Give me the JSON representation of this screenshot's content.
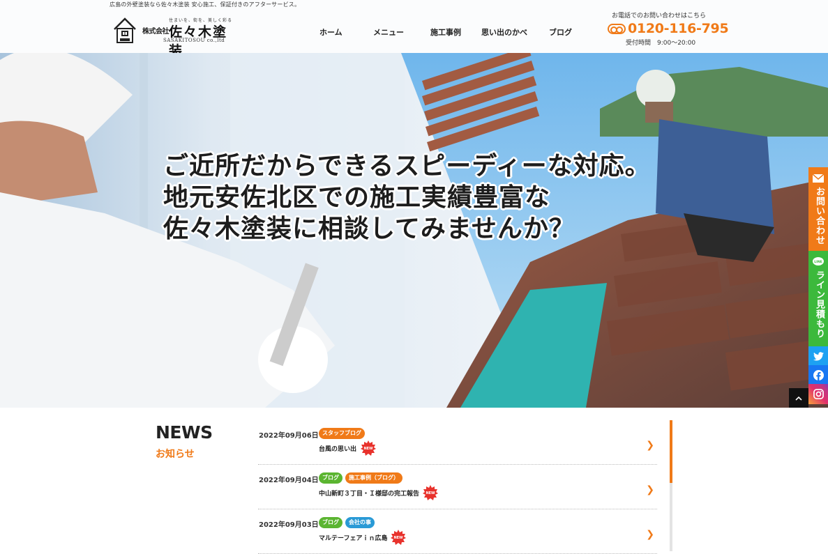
{
  "header": {
    "tagline": "広島の外壁塗装なら佐々木塗装 安心施工、保証付きのアフターサービス。",
    "logo": {
      "small_text": "住まいを、街を、美しく彩る",
      "kabushiki": "株式会社",
      "name": "佐々木塗装",
      "roman": "SASAKITOSOU co.,ltd"
    },
    "nav": [
      {
        "label": "ホーム"
      },
      {
        "label": "メニュー"
      },
      {
        "label": "施工事例"
      },
      {
        "label": "思い出のかべ"
      },
      {
        "label": "ブログ"
      }
    ],
    "contact_note": "お電話でのお問い合わせはこちら",
    "phone": "0120-116-795",
    "hours": "受付時間　9:00〜20:00"
  },
  "hero": {
    "lines": [
      "ご近所だからできるスピーディーな対応。",
      "地元安佐北区での施工実績豊富な",
      "佐々木塗装に相談してみませんか？"
    ]
  },
  "side": {
    "contact": "お問い合わせ",
    "line": "ライン見積もり",
    "twitter_icon": "twitter-icon",
    "facebook_icon": "facebook-icon",
    "instagram_icon": "instagram-icon",
    "pagetop": "^"
  },
  "news": {
    "title": "NEWS",
    "subtitle": "お知らせ",
    "items": [
      {
        "date": "2022年09月06日",
        "tags": [
          {
            "label": "スタッフブログ",
            "color": "#f07a18"
          }
        ],
        "headline": "台風の思い出",
        "new": "NEW"
      },
      {
        "date": "2022年09月04日",
        "tags": [
          {
            "label": "ブログ",
            "color": "#5bb531"
          },
          {
            "label": "施工事例（ブログ）",
            "color": "#f07a18"
          }
        ],
        "headline": "中山新町３丁目・Ｉ様邸の完工報告",
        "new": "NEW"
      },
      {
        "date": "2022年09月03日",
        "tags": [
          {
            "label": "ブログ",
            "color": "#5bb531"
          },
          {
            "label": "会社の事",
            "color": "#2a9ad6"
          }
        ],
        "headline": "マルテーフェアｉｎ広島",
        "new": "NEW"
      }
    ]
  },
  "colors": {
    "accent": "#f07a18",
    "line_green": "#3cb93c",
    "blue_tag": "#2a9ad6",
    "green_tag": "#5bb531"
  }
}
